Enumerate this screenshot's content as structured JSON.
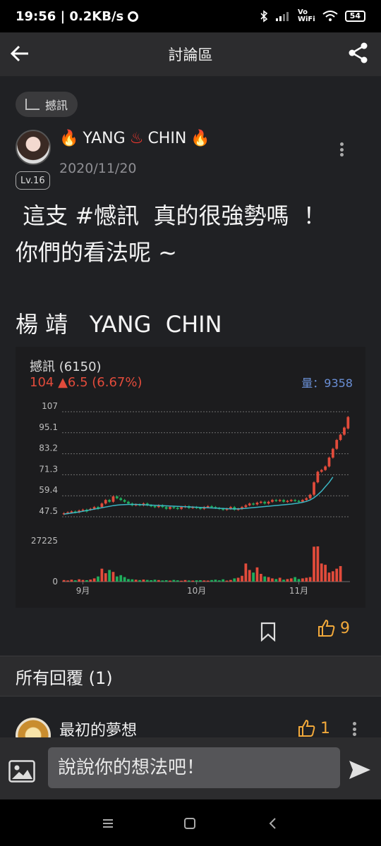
{
  "status_bar": {
    "time_speed": "19:56 | 0.2KB/s",
    "network": "Vo\nWiFi",
    "battery": "54"
  },
  "app_bar": {
    "title": "討論區"
  },
  "tag": {
    "label": "撼訊"
  },
  "post": {
    "author_prefix": "🔥",
    "author_name": "YANG",
    "author_mid": "♨",
    "author_name2": "CHIN",
    "author_suffix": "🔥",
    "level": "Lv.16",
    "date": "2020/11/20",
    "body": " 這支 #憾訊  真的很強勢嗎  ！\n你們的看法呢 ~",
    "signature": "楊 靖   YANG  CHIN"
  },
  "stock": {
    "name": "撼訊 (6150)",
    "price_line": "104 ▲6.5 (6.67%)",
    "volume_line": "量：9358"
  },
  "chart_data": {
    "type": "candlestick",
    "price_axis_ticks": [
      "107",
      "95.1",
      "83.2",
      "71.3",
      "59.4",
      "47.5"
    ],
    "price_ylim": [
      47.5,
      107
    ],
    "volume_axis_ticks": [
      "27225",
      "0"
    ],
    "volume_ylim": [
      0,
      27225
    ],
    "x_labels": [
      "9月",
      "10月",
      "11月"
    ],
    "x_label_positions": [
      5,
      35,
      62
    ],
    "close": [
      49.5,
      50,
      50.5,
      50,
      51,
      51.5,
      50.5,
      52,
      53,
      52,
      55,
      57,
      56,
      59,
      58,
      57,
      56,
      55,
      54,
      54.5,
      54,
      55,
      54,
      53.5,
      53,
      54,
      53,
      52,
      53,
      52.5,
      52,
      53,
      53.5,
      52.5,
      53,
      52.5,
      52,
      53,
      53.5,
      53,
      52.5,
      52,
      51.5,
      52,
      53,
      51.5,
      52,
      53,
      54,
      55,
      54.5,
      55.5,
      56,
      55,
      56,
      57,
      56.5,
      57,
      56,
      56.5,
      57,
      56.5,
      56,
      57,
      58,
      60,
      67,
      73,
      74,
      76,
      81,
      86,
      91,
      94,
      98,
      104
    ],
    "open": [
      49,
      49.5,
      50,
      50.5,
      50,
      51,
      51.5,
      51.5,
      52,
      53,
      53,
      55,
      57,
      56,
      59,
      58,
      57,
      56,
      55,
      54,
      54.5,
      54,
      55,
      54,
      53.5,
      53,
      54,
      53,
      52,
      53,
      52.5,
      52,
      53,
      53.5,
      52.5,
      53,
      52.5,
      52,
      53,
      53.5,
      53,
      52.5,
      52,
      51.5,
      52,
      53,
      51.5,
      52,
      53,
      54,
      55,
      54.5,
      55.5,
      56,
      55,
      56,
      57,
      56.5,
      57,
      56,
      56.5,
      57,
      56.5,
      56,
      57,
      58,
      60,
      67,
      73,
      74,
      76,
      81,
      86,
      91,
      94,
      97.5
    ],
    "ma": [
      49,
      49.3,
      49.6,
      49.9,
      50.2,
      50.6,
      51,
      51.4,
      51.8,
      52.2,
      52.6,
      53,
      53.4,
      53.8,
      54.1,
      54.3,
      54.4,
      54.5,
      54.5,
      54.5,
      54.4,
      54.3,
      54.2,
      54.1,
      54,
      53.9,
      53.8,
      53.7,
      53.6,
      53.5,
      53.4,
      53.3,
      53.2,
      53.1,
      53,
      52.9,
      52.8,
      52.7,
      52.6,
      52.5,
      52.4,
      52.3,
      52.2,
      52.1,
      52,
      52,
      52,
      52.1,
      52.3,
      52.5,
      52.7,
      52.9,
      53.1,
      53.3,
      53.5,
      53.7,
      53.9,
      54.1,
      54.3,
      54.5,
      54.7,
      55,
      55.3,
      55.7,
      56.2,
      57,
      58.3,
      60,
      62,
      64.5,
      67,
      70
    ],
    "volume": [
      1200,
      900,
      1500,
      1000,
      1800,
      1300,
      1100,
      1600,
      2500,
      4000,
      10000,
      6500,
      9000,
      7500,
      4000,
      5000,
      3500,
      2000,
      1800,
      1500,
      1200,
      1600,
      1300,
      1100,
      1500,
      1200,
      900,
      1100,
      800,
      1300,
      1000,
      700,
      1200,
      900,
      800,
      1000,
      1100,
      900,
      800,
      1200,
      1500,
      1000,
      1800,
      800,
      1300,
      2500,
      3000,
      4500,
      14000,
      9000,
      7000,
      11000,
      6000,
      4000,
      3500,
      2500,
      2000,
      3000,
      1500,
      2000,
      2500,
      3500,
      2000,
      2500,
      3000,
      3500,
      27000,
      28000,
      14000,
      13000,
      7000,
      8000,
      10000,
      12000
    ],
    "colors": {
      "up": "#e24b3b",
      "down": "#1fae5c",
      "ma": "#3bb6c4",
      "grid": "#6e6e6e",
      "axis_text": "#bdbdbd"
    }
  },
  "actions": {
    "likes": "9"
  },
  "replies": {
    "header": "所有回覆 (1)",
    "items": [
      {
        "name": "最初的夢想",
        "likes": "1"
      }
    ]
  },
  "comment": {
    "placeholder": "說說你的想法吧！"
  }
}
